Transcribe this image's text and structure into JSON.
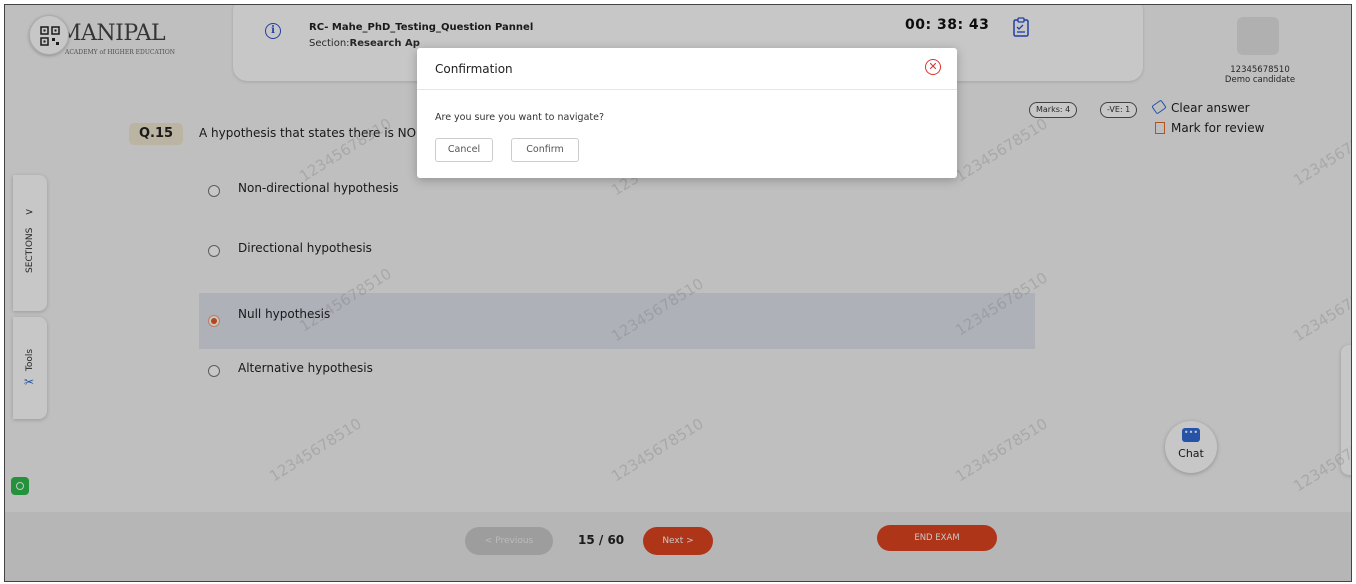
{
  "header": {
    "logo_text": "MANIPAL",
    "logo_subtitle": "ACADEMY of HIGHER EDUCATION",
    "test_title": "RC- Mahe_PhD_Testing_Question Pannel",
    "section_prefix": "Section:",
    "section_name": "Research Ap",
    "timer": "00: 38: 43",
    "candidate_id": "12345678510",
    "candidate_name": "Demo candidate"
  },
  "question": {
    "number": "Q.15",
    "text": "A hypothesis that states there is NO",
    "marks": "Marks: 4",
    "negative": "-VE: 1",
    "clear_answer": "Clear answer",
    "mark_for_review": "Mark for review",
    "options": [
      {
        "label": "Non-directional hypothesis",
        "selected": false
      },
      {
        "label": "Directional hypothesis",
        "selected": false
      },
      {
        "label": "Null hypothesis",
        "selected": true
      },
      {
        "label": "Alternative hypothesis",
        "selected": false
      }
    ]
  },
  "side": {
    "sections_label": "SECTIONS",
    "sections_arrow": ">",
    "tools_label": "Tools"
  },
  "watermark": "12345678510",
  "chat": {
    "label": "Chat"
  },
  "footer": {
    "previous": "< Previous",
    "page": "15 / 60",
    "next": "Next  >",
    "end_exam": "END EXAM"
  },
  "modal": {
    "title": "Confirmation",
    "message": "Are you sure you want to navigate?",
    "cancel": "Cancel",
    "confirm": "Confirm"
  },
  "colors": {
    "accent": "#e0451f",
    "link_blue": "#2b4fd6",
    "selected_row": "#e1e3ee"
  }
}
